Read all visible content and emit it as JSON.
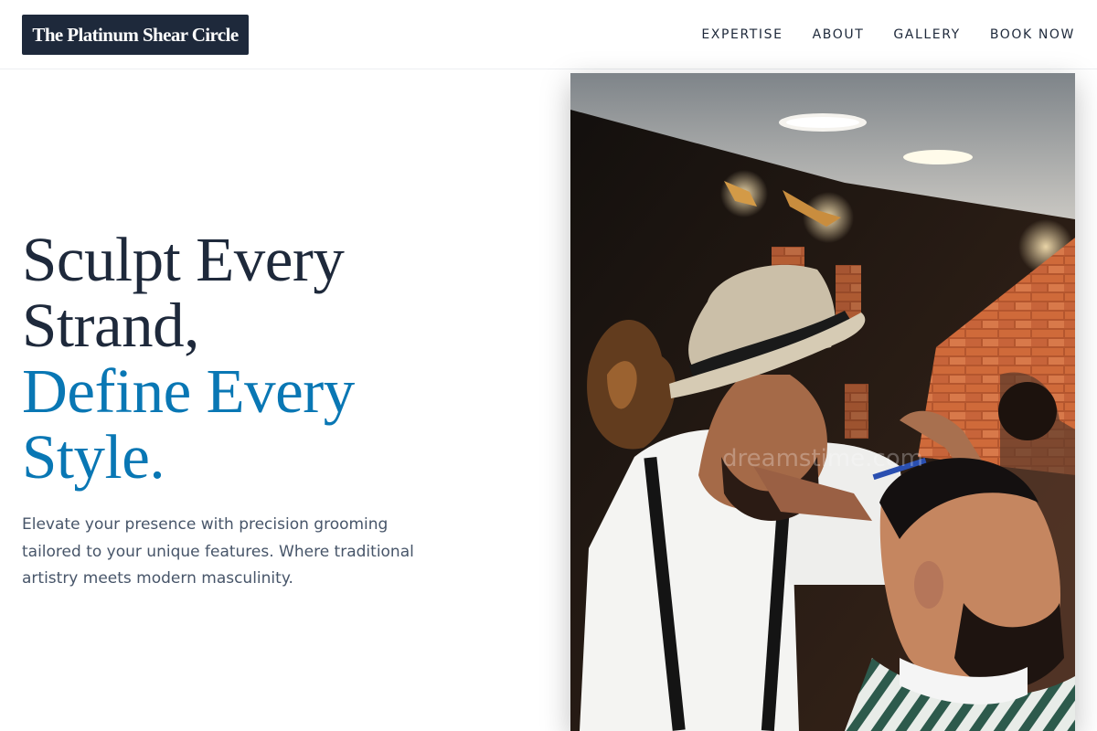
{
  "brand": {
    "name": "The Platinum Shear Circle",
    "colors": {
      "primary": "#1e293b",
      "accent": "#0977b4",
      "muted": "#475569"
    }
  },
  "nav": {
    "items": [
      {
        "label": "EXPERTISE"
      },
      {
        "label": "ABOUT"
      },
      {
        "label": "GALLERY"
      },
      {
        "label": "BOOK NOW"
      }
    ]
  },
  "hero": {
    "headline_lines": [
      "Sculpt Every",
      "Strand,"
    ],
    "accent_lines": [
      "Define Every",
      "Style."
    ],
    "subtext": "Elevate your presence with precision grooming tailored to your unique features. Where traditional artistry meets modern masculinity.",
    "image": {
      "watermark": "dreamstime.com"
    }
  }
}
